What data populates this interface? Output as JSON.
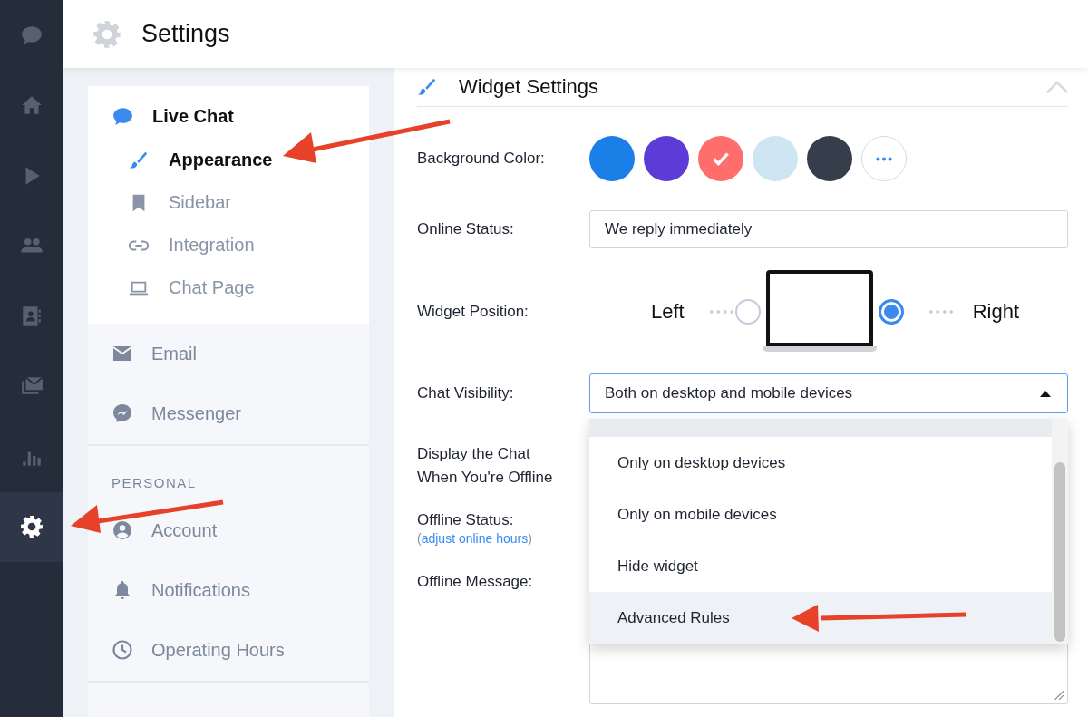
{
  "rail": [
    {
      "kind": "chat",
      "selected": false
    },
    {
      "kind": "home",
      "selected": false
    },
    {
      "kind": "play",
      "selected": false
    },
    {
      "kind": "people",
      "selected": false
    },
    {
      "kind": "contacts",
      "selected": false
    },
    {
      "kind": "mail",
      "selected": false
    },
    {
      "kind": "chart",
      "selected": false
    },
    {
      "kind": "gear",
      "selected": true
    }
  ],
  "header": {
    "title": "Settings"
  },
  "live_chat": {
    "title": "Live Chat",
    "items": [
      {
        "label": "Appearance",
        "selected": true
      },
      {
        "label": "Sidebar",
        "selected": false
      },
      {
        "label": "Integration",
        "selected": false
      },
      {
        "label": "Chat Page",
        "selected": false
      }
    ]
  },
  "channels": [
    {
      "label": "Email"
    },
    {
      "label": "Messenger"
    }
  ],
  "personal": {
    "heading": "PERSONAL",
    "items": [
      {
        "label": "Account"
      },
      {
        "label": "Notifications"
      },
      {
        "label": "Operating Hours"
      }
    ]
  },
  "widget": {
    "title": "Widget Settings",
    "background_label": "Background Color:",
    "swatches": [
      {
        "color": "#1a7fe6",
        "selected": false
      },
      {
        "color": "#5c3bd6",
        "selected": false
      },
      {
        "color": "#ff6e6a",
        "selected": true
      },
      {
        "color": "#cde6f2",
        "selected": false
      },
      {
        "color": "#363e4b",
        "selected": false
      }
    ],
    "online_label": "Online Status:",
    "online_value": "We reply immediately",
    "position_label": "Widget Position:",
    "positions": [
      {
        "label": "Left",
        "selected": false
      },
      {
        "label": "Right",
        "selected": true
      }
    ],
    "visibility_label": "Chat Visibility:",
    "visibility_value": "Both on desktop and mobile devices",
    "visibility_expanded": true,
    "visibility_options": [
      {
        "label": "Only on desktop devices",
        "highlighted": false
      },
      {
        "label": "Only on mobile devices",
        "highlighted": false
      },
      {
        "label": "Hide widget",
        "highlighted": false
      },
      {
        "label": "Advanced Rules",
        "highlighted": true
      }
    ],
    "offline_display_label": "Display the Chat When You're Offline",
    "offline_status_label": "Offline Status:",
    "hours_open": "(",
    "hours_link": "adjust online hours",
    "hours_close": ")",
    "offline_message_label": "Offline Message:"
  }
}
